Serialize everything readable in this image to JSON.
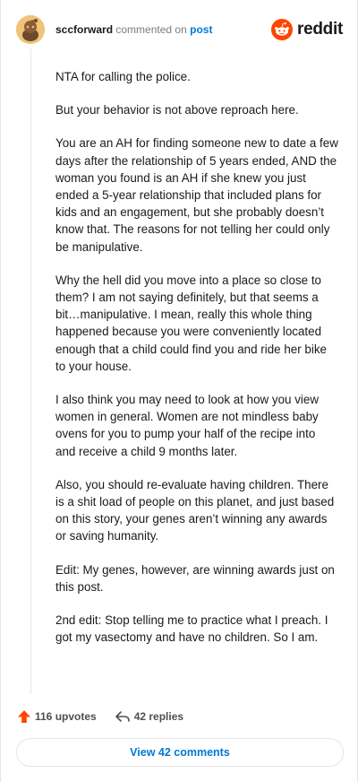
{
  "header": {
    "username": "sccforward",
    "commented_text": "commented on",
    "post_link": "post",
    "brand": "reddit",
    "avatar_icon": "snoo-avatar-icon",
    "brand_icon": "reddit-snoo-icon"
  },
  "comment": {
    "paragraphs": [
      "NTA for calling the police.",
      "But your behavior is not above reproach here.",
      "You are an AH for finding someone new to date a few days after the relationship of 5 years ended, AND the woman you found is an AH if she knew you just ended a 5-year relationship that included plans for kids and an engagement, but she probably doesn’t know that. The reasons for not telling her could only be manipulative.",
      "Why the hell did you move into a place so close to them? I am not saying definitely, but that seems a bit…manipulative. I mean, really this whole thing happened because you were conveniently located enough that a child could find you and ride her bike to your house.",
      "I also think you may need to look at how you view women in general. Women are not mindless baby ovens for you to pump your half of the recipe into and receive a child 9 months later.",
      "Also, you should re-evaluate having children. There is a shit load of people on this planet, and just based on this story, your genes aren’t winning any awards or saving humanity.",
      "Edit: My genes, however, are winning awards just on this post.",
      "2nd edit: Stop telling me to practice what I preach. I got my vasectomy and have no children. So I am."
    ]
  },
  "footer": {
    "upvotes": "116 upvotes",
    "replies": "42 replies",
    "upvote_icon": "upvote-arrow-icon",
    "reply_icon": "reply-arrow-icon"
  },
  "view_comments_label": "View 42 comments",
  "colors": {
    "brand_orange": "#ff4500",
    "link_blue": "#0079d3",
    "muted_text": "#7c7c7c"
  }
}
